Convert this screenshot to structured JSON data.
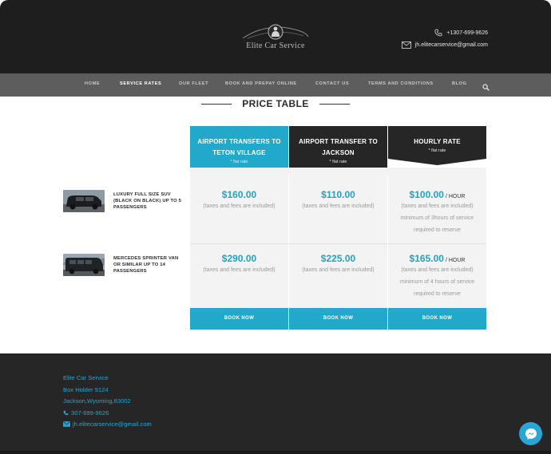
{
  "header": {
    "logo_text": "Elite Car Service",
    "phone": "+1307-699-9626",
    "email": "jh.elitecarservice@gmail.com"
  },
  "nav": {
    "items": [
      {
        "label": "HOME",
        "active": false
      },
      {
        "label": "SERVICE RATES",
        "active": true
      },
      {
        "label": "OUR FLEET",
        "active": false
      },
      {
        "label": "BOOK AND PREPAY ONLINE",
        "active": false
      },
      {
        "label": "CONTACT US",
        "active": false
      },
      {
        "label": "TERMS AND CONDITIONS",
        "active": false
      },
      {
        "label": "BLOG",
        "active": false
      }
    ],
    "search_icon": "search-icon"
  },
  "page": {
    "title": "PRICE TABLE"
  },
  "table": {
    "columns": [
      {
        "label_line1": "AIRPORT TRANSFERS TO",
        "label_line2": "TETON VILLAGE",
        "sub": "* flat rate",
        "color": "#21a8cb"
      },
      {
        "label_line1": "AIRPORT TRANSFER TO",
        "label_line2": "JACKSON",
        "sub": "* flat rate",
        "color": "#262626"
      },
      {
        "label_line1": "HOURLY RATE",
        "label_line2": "",
        "sub": "* flat rate",
        "color": "#262626"
      }
    ],
    "rows": [
      {
        "vehicle": "LUXURY FULL SIZE SUV (BLACK ON BLACK) UP TO 5 PASSENGERS",
        "cells": [
          {
            "price": "$160.00",
            "unit": "",
            "notes": [
              "(taxes and fees are included)"
            ]
          },
          {
            "price": "$110.00",
            "unit": "",
            "notes": [
              "(taxes and fees are included)"
            ]
          },
          {
            "price": "$100.00",
            "unit": "/ HOUR",
            "notes": [
              "(taxes and fees are included)",
              "minimum of 3hours of service",
              "required to reserve"
            ]
          }
        ]
      },
      {
        "vehicle": "MERCEDES SPRINTER VAN OR SIMILAR UP TO 14 PASSENGERS",
        "cells": [
          {
            "price": "$290.00",
            "unit": "",
            "notes": [
              "(taxes and fees are included)"
            ]
          },
          {
            "price": "$225.00",
            "unit": "",
            "notes": [
              "(taxes and fees are included)"
            ]
          },
          {
            "price": "$165.00",
            "unit": "/ HOUR",
            "notes": [
              "(taxes and fees are included)",
              "minimum of 4 hours of service",
              "required to reserve"
            ]
          }
        ]
      }
    ],
    "book_label": "BOOK NOW"
  },
  "footer": {
    "company": "Elite Car Service",
    "address1": "Box Holder 9124",
    "address2": "Jackson,Wyoming,83002",
    "phone": "307-699-9626",
    "email": "jh.elitecarservice@gmail.com"
  },
  "widgets": {
    "messenger_icon": "messenger-icon"
  }
}
